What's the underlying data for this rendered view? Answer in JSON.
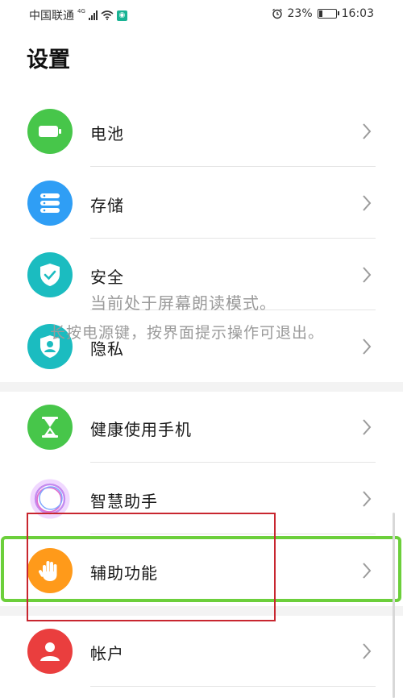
{
  "status_bar": {
    "carrier": "中国联通",
    "network": "4G",
    "alarm_icon": "alarm-clock-icon",
    "battery_percent": "23%",
    "battery_level": 0.23,
    "time": "16:03"
  },
  "header": {
    "title": "设置"
  },
  "settings": {
    "items": [
      {
        "label": "电池",
        "icon": "battery-icon",
        "color": "#47c64a"
      },
      {
        "label": "存储",
        "icon": "storage-icon",
        "color": "#2f9ef5"
      },
      {
        "label": "安全",
        "icon": "shield-check-icon",
        "color": "#1bbcc0"
      },
      {
        "label": "隐私",
        "icon": "privacy-shield-icon",
        "color": "#1bbcc0"
      },
      {
        "label": "健康使用手机",
        "icon": "hourglass-icon",
        "color": "#47c64a"
      },
      {
        "label": "智慧助手",
        "icon": "smart-assistant-icon",
        "color": "#b97ae6"
      },
      {
        "label": "辅助功能",
        "icon": "hand-icon",
        "color": "#ff9a1a"
      },
      {
        "label": "帐户",
        "icon": "account-icon",
        "color": "#ea3e3e"
      }
    ]
  },
  "overlay": {
    "line1": "当前处于屏幕朗读模式。",
    "line2": "长按电源键，按界面提示操作可退出。"
  },
  "highlight_colors": {
    "focus_green": "#6ccf3b",
    "annotation_red": "#c8262f"
  }
}
